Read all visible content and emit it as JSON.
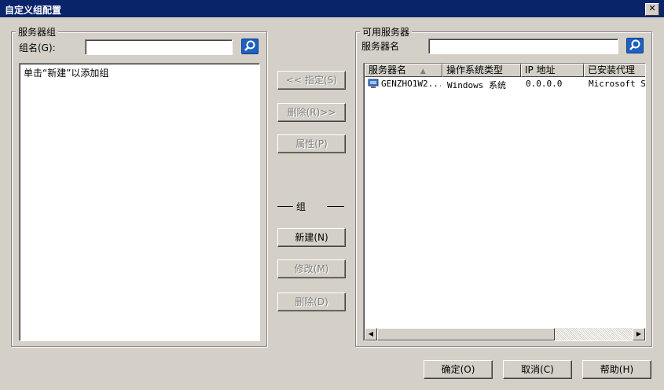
{
  "window": {
    "title": "自定义组配置",
    "close_label": "✕"
  },
  "left_group": {
    "legend": "服务器组",
    "group_name_label": "组名(G):",
    "group_name_value": "",
    "hint": "单击“新建”以添加组"
  },
  "middle": {
    "assign_label": "<< 指定(S)",
    "remove_label": "删除(R)>>",
    "properties_label": "属性(P)",
    "group_section_label": "组",
    "new_label": "新建(N)",
    "modify_label": "修改(M)",
    "delete_label": "删除(D)"
  },
  "right_group": {
    "legend": "可用服务器",
    "server_name_label": "服务器名",
    "server_name_value": "",
    "columns": [
      "服务器名",
      "操作系统类型",
      "IP 地址",
      "已安装代理"
    ],
    "sort_indicator": "▲",
    "rows": [
      {
        "name": "GENZHO1W2...",
        "os": "Windows 系统",
        "ip": "0.0.0.0",
        "agent": "Microsoft SQ"
      }
    ]
  },
  "footer": {
    "ok_label": "确定(O)",
    "cancel_label": "取消(C)",
    "help_label": "帮助(H)"
  },
  "icons": {
    "search": "magnifier-icon",
    "server": "computer-icon",
    "scroll_left": "◀",
    "scroll_right": "▶"
  }
}
